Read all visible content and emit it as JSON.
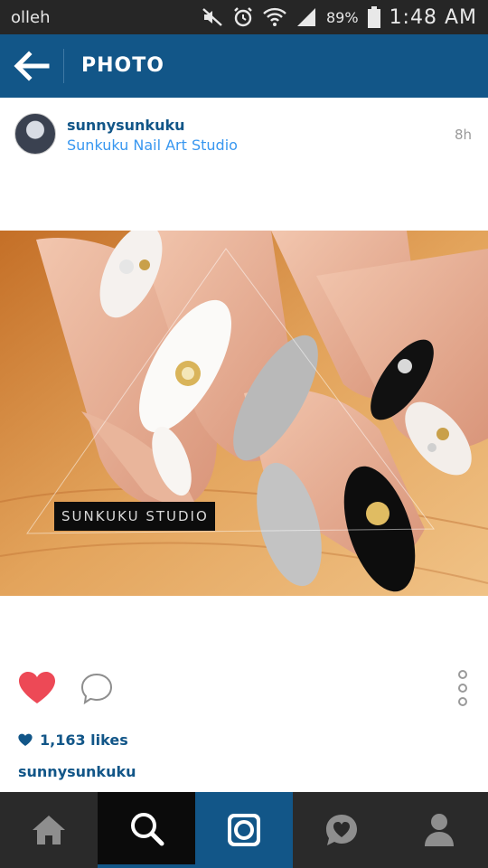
{
  "status_bar": {
    "carrier": "olleh",
    "battery": "89%",
    "time": "1:48 AM",
    "icons": [
      "mute-icon",
      "alarm-icon",
      "wifi-icon",
      "signal-icon",
      "battery-icon"
    ]
  },
  "action_bar": {
    "title": "PHOTO",
    "back_icon": "arrow-left-icon"
  },
  "post": {
    "username": "sunnysunkuku",
    "location": "Sunkuku Nail Art Studio",
    "time_ago": "8h",
    "photo_watermark": "SUNKUKU STUDIO",
    "likes": "1,163 likes",
    "caption_username": "sunnysunkuku",
    "liked": true
  },
  "bottom_nav": [
    {
      "name": "home-icon",
      "selected": false
    },
    {
      "name": "search-icon",
      "selected": true
    },
    {
      "name": "camera-icon",
      "selected": false
    },
    {
      "name": "activity-icon",
      "selected": false
    },
    {
      "name": "profile-icon",
      "selected": false
    }
  ],
  "colors": {
    "accent": "#125688",
    "link": "#3897f0",
    "heart": "#ed4956",
    "nav_bg": "#2a2a2a"
  }
}
